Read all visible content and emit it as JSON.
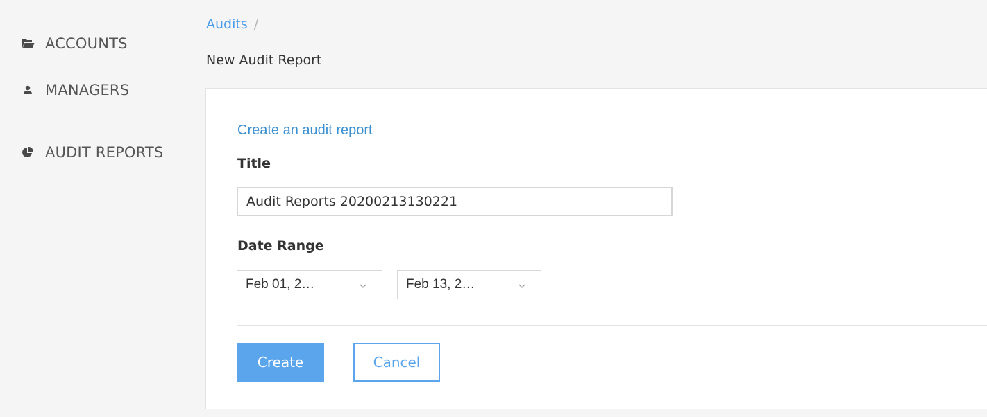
{
  "sidebar": {
    "items": [
      {
        "label": "ACCOUNTS",
        "icon": "folder-icon"
      },
      {
        "label": "MANAGERS",
        "icon": "user-icon"
      },
      {
        "label": "AUDIT REPORTS",
        "icon": "pie-chart-icon"
      }
    ]
  },
  "breadcrumb": {
    "parent": "Audits",
    "separator": "/"
  },
  "page": {
    "title": "New Audit Report"
  },
  "form": {
    "heading": "Create an audit report",
    "title_label": "Title",
    "title_value": "Audit Reports 20200213130221",
    "date_range_label": "Date Range",
    "date_from": "Feb 01, 2…",
    "date_to": "Feb 13, 2…",
    "create_label": "Create",
    "cancel_label": "Cancel"
  },
  "colors": {
    "accent": "#5aa5ec",
    "link": "#4a9be8",
    "heading": "#3a8fd0",
    "background": "#f5f5f5"
  }
}
